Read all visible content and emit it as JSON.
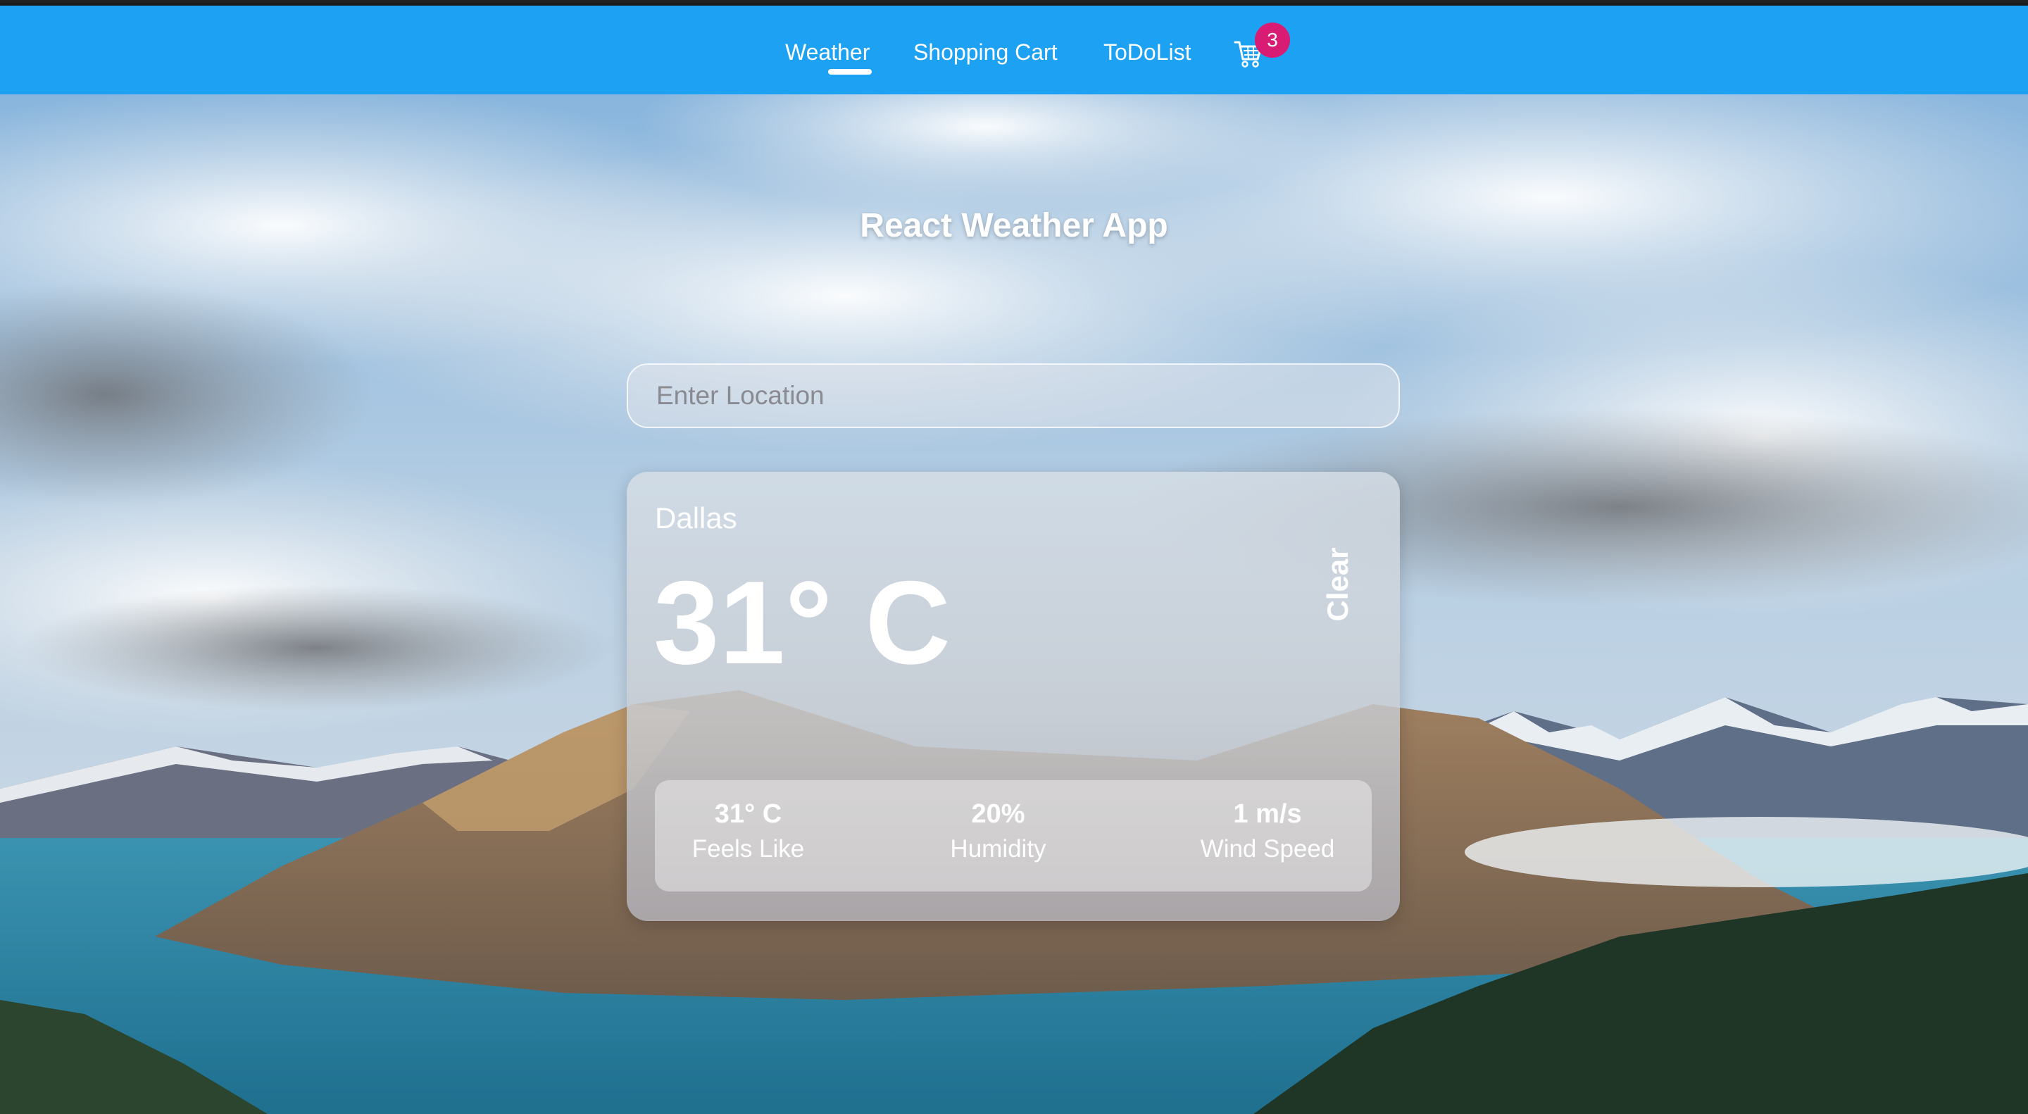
{
  "nav": {
    "items": [
      {
        "label": "Weather",
        "active": true
      },
      {
        "label": "Shopping Cart",
        "active": false
      },
      {
        "label": "ToDoList",
        "active": false
      }
    ],
    "cart_icon": "shopping-cart-icon",
    "cart_count": "3",
    "accent_color": "#1da1f2",
    "badge_color": "#d81b73"
  },
  "app": {
    "title": "React Weather App"
  },
  "search": {
    "placeholder": "Enter Location",
    "value": ""
  },
  "weather": {
    "city": "Dallas",
    "temperature": "31° C",
    "condition": "Clear",
    "details": [
      {
        "value": "31° C",
        "label": "Feels Like"
      },
      {
        "value": "20%",
        "label": "Humidity"
      },
      {
        "value": "1 m/s",
        "label": "Wind Speed"
      }
    ]
  }
}
